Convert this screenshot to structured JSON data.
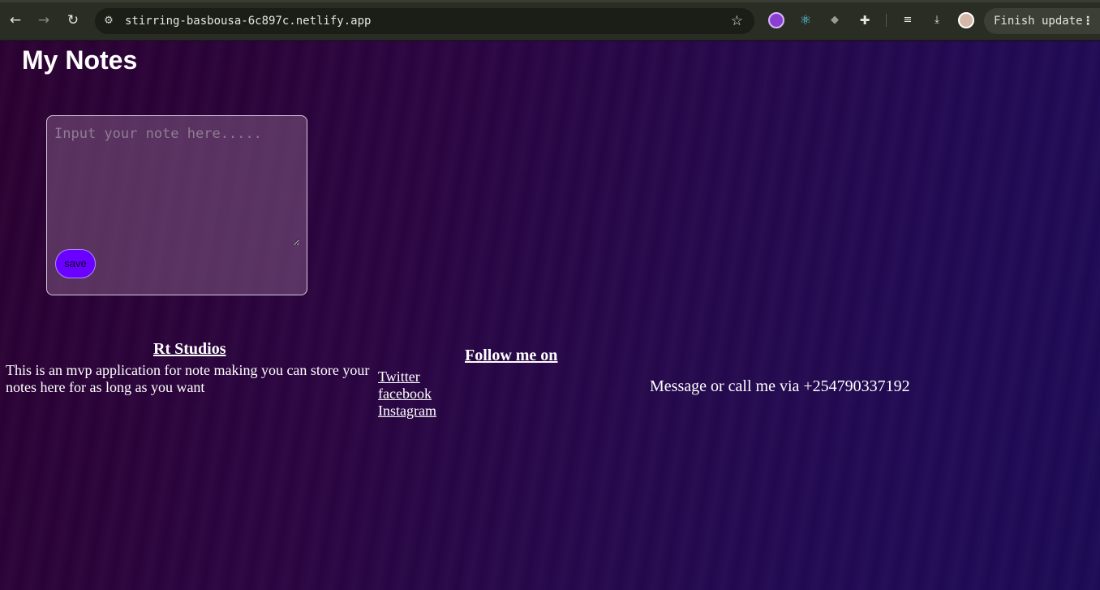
{
  "browser": {
    "url": "stirring-basbousa-6c897c.netlify.app",
    "finish_update_label": "Finish update",
    "icons": {
      "back": "arrow-left-icon",
      "forward": "arrow-right-icon",
      "reload": "reload-icon",
      "site_info": "tune-icon",
      "bookmark": "star-icon",
      "ext1": "extension-purple-icon",
      "ext2": "react-devtools-icon",
      "ext3": "robot-icon",
      "extensions": "puzzle-icon",
      "media": "media-queue-icon",
      "downloads": "download-icon",
      "menu": "kebab-menu-icon"
    }
  },
  "app": {
    "title": "My Notes",
    "note_input": {
      "placeholder": "Input your note here.....",
      "value": ""
    },
    "save_label": "save",
    "colors": {
      "save_button": "#6a00ff",
      "background": "#240845"
    }
  },
  "footer": {
    "about": {
      "heading": "Rt Studios",
      "text": "This is an mvp application for note making you can store your notes here for as long as you want"
    },
    "social": {
      "heading": "Follow me on",
      "links": [
        "Twitter",
        "facebook",
        "Instagram"
      ]
    },
    "contact": "Message or call me via +254790337192"
  }
}
